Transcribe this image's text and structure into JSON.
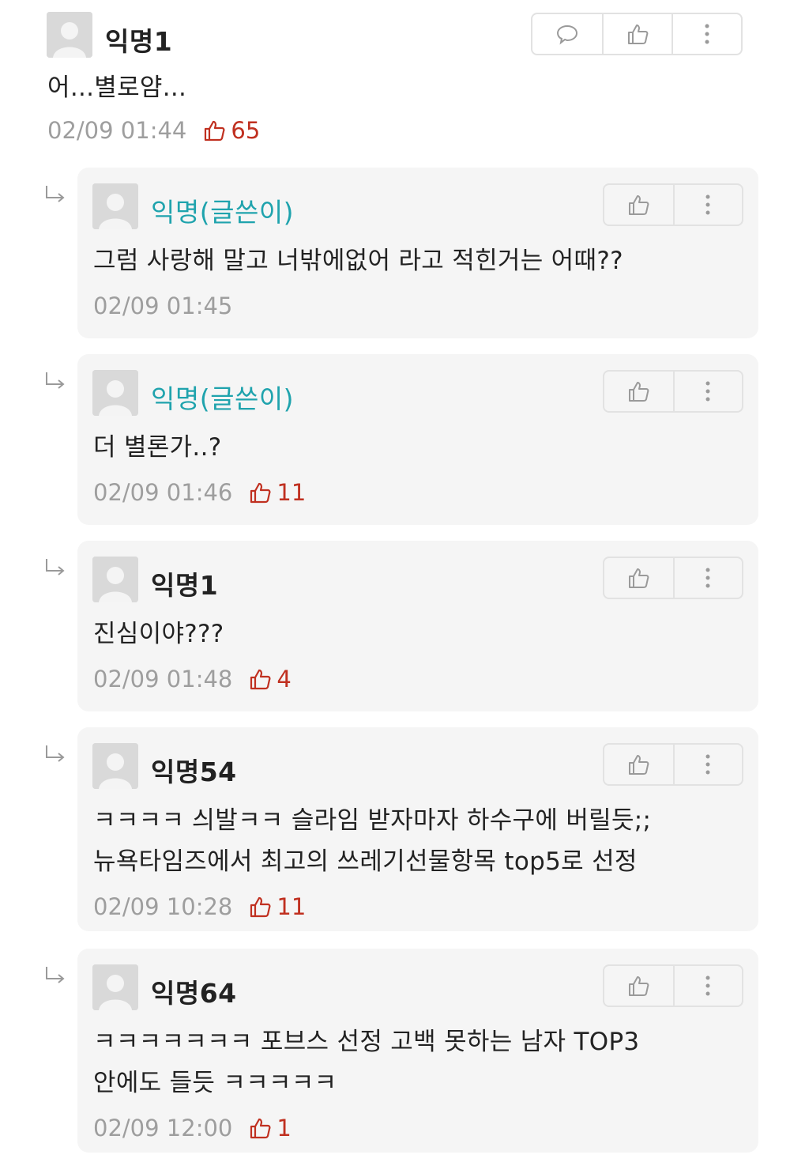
{
  "comments": [
    {
      "author": "익명1",
      "text_lines": [
        "어...별로얌..."
      ],
      "timestamp": "02/09 01:44",
      "likes": "65",
      "author_color": "#222222"
    }
  ],
  "replies": [
    {
      "author": "익명(글쓴이)",
      "text_lines": [
        "그럼 사랑해 말고 너밖에없어 라고 적힌거는 어때??"
      ],
      "timestamp": "02/09 01:45",
      "likes": "",
      "author_color": "#1fa3ad"
    },
    {
      "author": "익명(글쓴이)",
      "text_lines": [
        "더 별론가..?"
      ],
      "timestamp": "02/09 01:46",
      "likes": "11",
      "author_color": "#1fa3ad"
    },
    {
      "author": "익명1",
      "text_lines": [
        "진심이야???"
      ],
      "timestamp": "02/09 01:48",
      "likes": "4",
      "author_color": "#222222"
    },
    {
      "author": "익명54",
      "text_lines": [
        "ㅋㅋㅋㅋ 싀발ㅋㅋ 슬라임 받자마자 하수구에 버릴듯;;",
        "뉴욕타임즈에서 최고의 쓰레기선물항목 top5로 선정"
      ],
      "timestamp": "02/09 10:28",
      "likes": "11",
      "author_color": "#222222"
    },
    {
      "author": "익명64",
      "text_lines": [
        "ㅋㅋㅋㅋㅋㅋㅋ 포브스 선정 고백 못하는 남자 TOP3",
        "안에도 들듯 ㅋㅋㅋㅋㅋ"
      ],
      "timestamp": "02/09 12:00",
      "likes": "1",
      "author_color": "#222222"
    }
  ],
  "colors": {
    "op_name": "#1fa3ad",
    "like_count": "#c03020",
    "timestamp": "#9e9e9e",
    "reply_background": "#f5f5f5"
  },
  "icons": {
    "reply_arrow": "reply-arrow-icon",
    "comment": "speech-bubble-icon",
    "like": "thumbs-up-icon",
    "more": "vertical-dots-icon",
    "avatar": "default-avatar-icon"
  }
}
